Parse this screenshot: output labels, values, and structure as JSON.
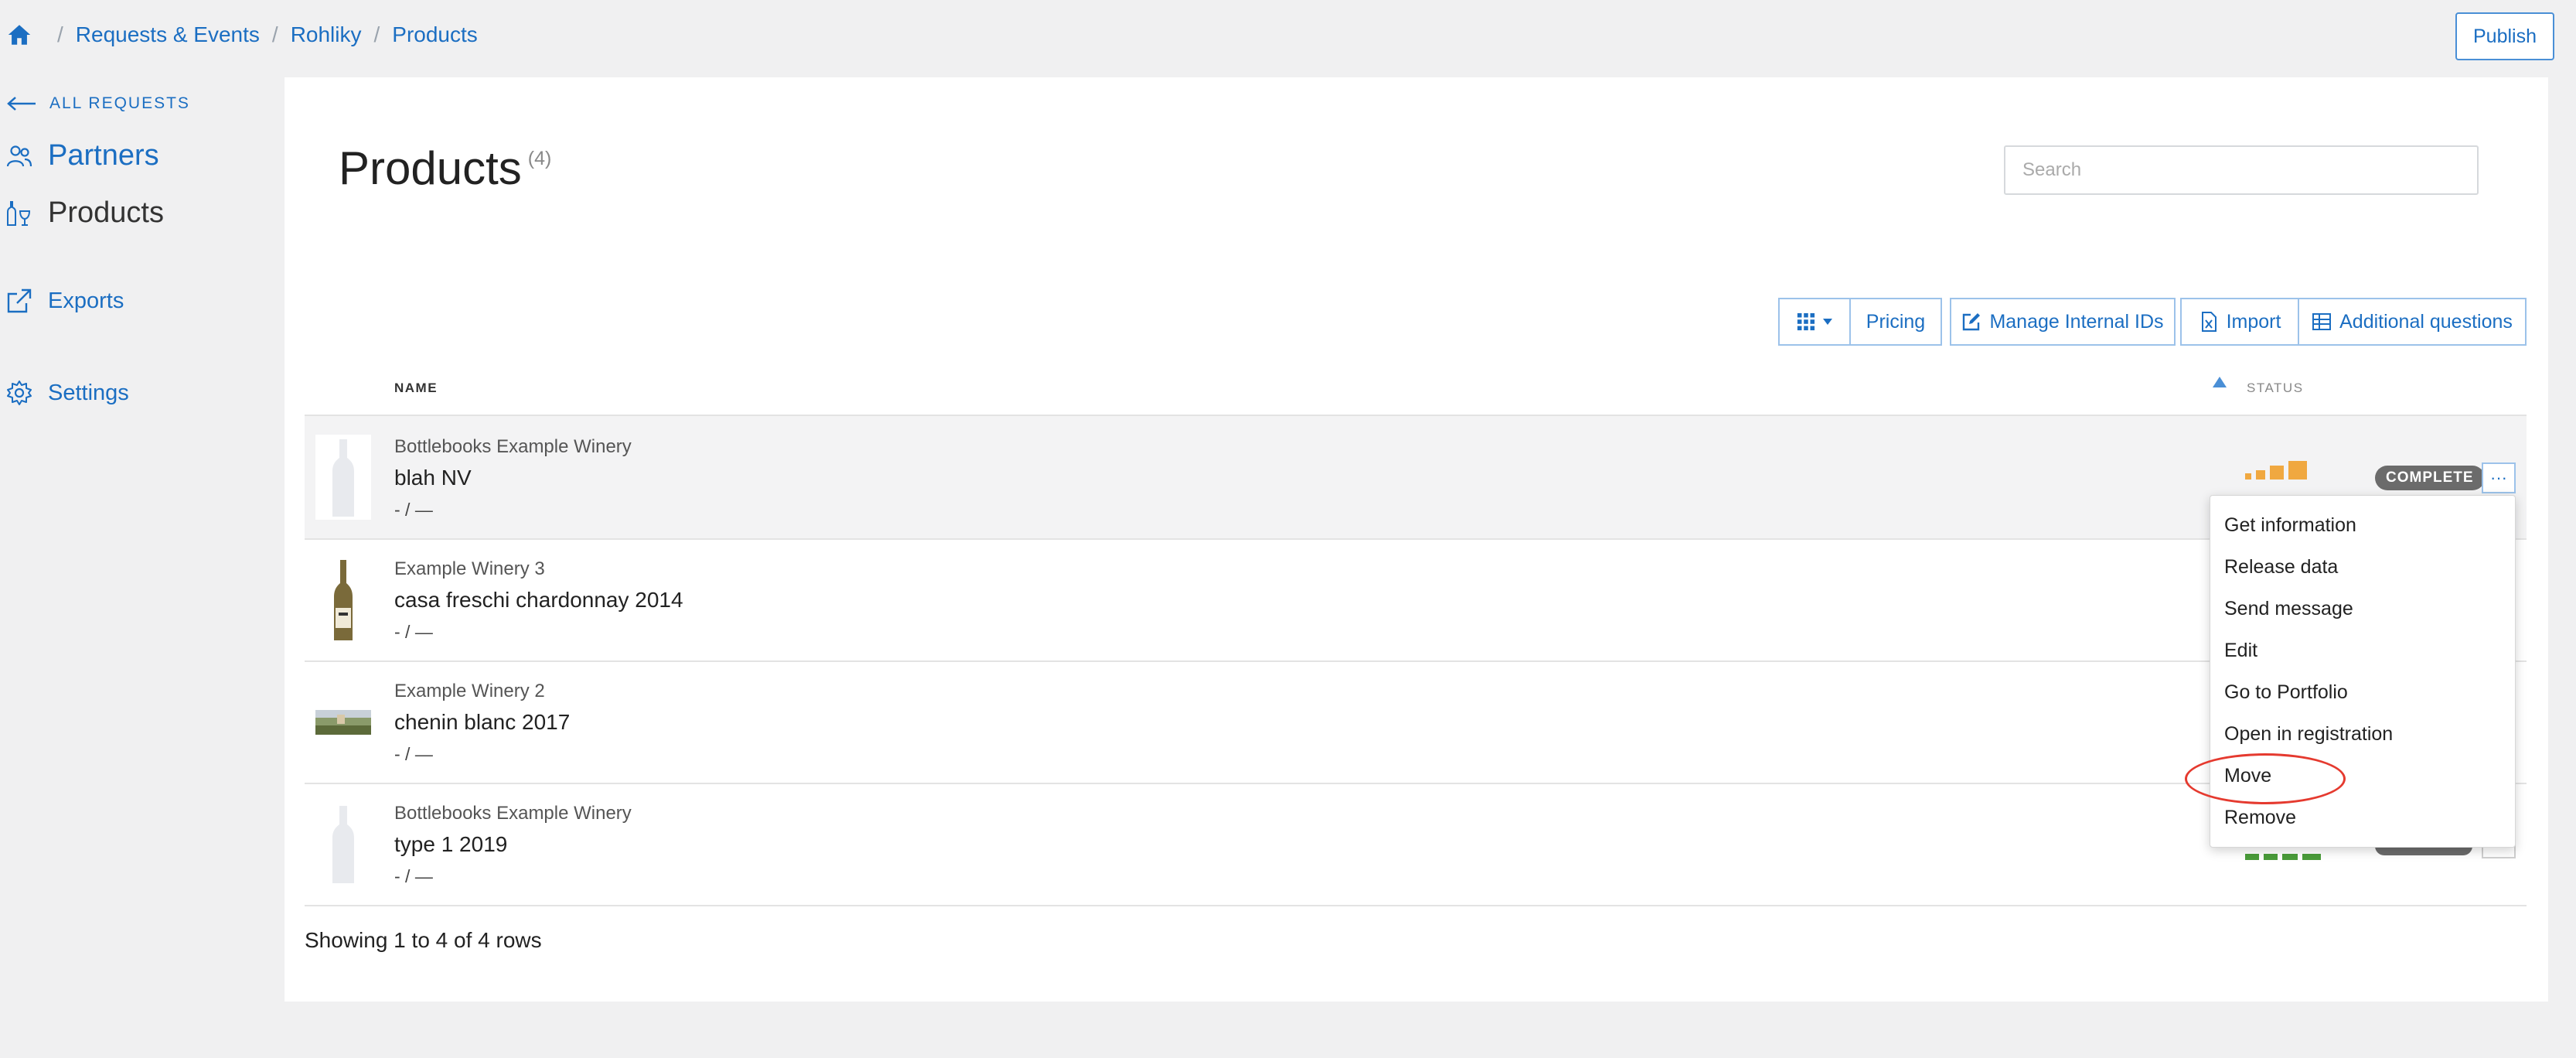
{
  "breadcrumb": {
    "items": [
      "Requests & Events",
      "Rohliky",
      "Products"
    ],
    "separator": "/"
  },
  "header": {
    "publish_label": "Publish"
  },
  "sidebar": {
    "back_label": "ALL REQUESTS",
    "items": [
      {
        "label": "Partners",
        "icon": "users-icon",
        "active": false
      },
      {
        "label": "Products",
        "icon": "wine-bottle-glass-icon",
        "active": true
      },
      {
        "label": "Exports",
        "icon": "external-link-icon",
        "active": false
      },
      {
        "label": "Settings",
        "icon": "gear-icon",
        "active": false
      }
    ]
  },
  "main": {
    "title": "Products",
    "count": "(4)",
    "search": {
      "placeholder": "Search",
      "value": ""
    }
  },
  "toolbar": {
    "grid_label": "",
    "pricing_label": "Pricing",
    "manage_ids_label": "Manage Internal IDs",
    "import_label": "Import",
    "additional_questions_label": "Additional questions"
  },
  "table": {
    "headers": {
      "name": "NAME",
      "status": "STATUS"
    },
    "sort_direction": "ascending",
    "rows": [
      {
        "producer": "Bottlebooks Example Winery",
        "name": "blah NV",
        "meta": "- / —",
        "status_badge": "COMPLETE",
        "status_color": "#f0a840"
      },
      {
        "producer": "Example Winery 3",
        "name": "casa freschi chardonnay 2014",
        "meta": "- / —"
      },
      {
        "producer": "Example Winery 2",
        "name": "chenin blanc 2017",
        "meta": "- / —"
      },
      {
        "producer": "Bottlebooks Example Winery",
        "name": "type 1 2019",
        "meta": "- / —",
        "status_color": "#4a9c3a"
      }
    ],
    "more_label": "···",
    "footer": "Showing 1 to 4 of 4 rows"
  },
  "context_menu": {
    "items": [
      "Get information",
      "Release data",
      "Send message",
      "Edit",
      "Go to Portfolio",
      "Open in registration",
      "Move",
      "Remove"
    ],
    "highlighted": "Move",
    "highlight_color": "#e53a2f"
  }
}
